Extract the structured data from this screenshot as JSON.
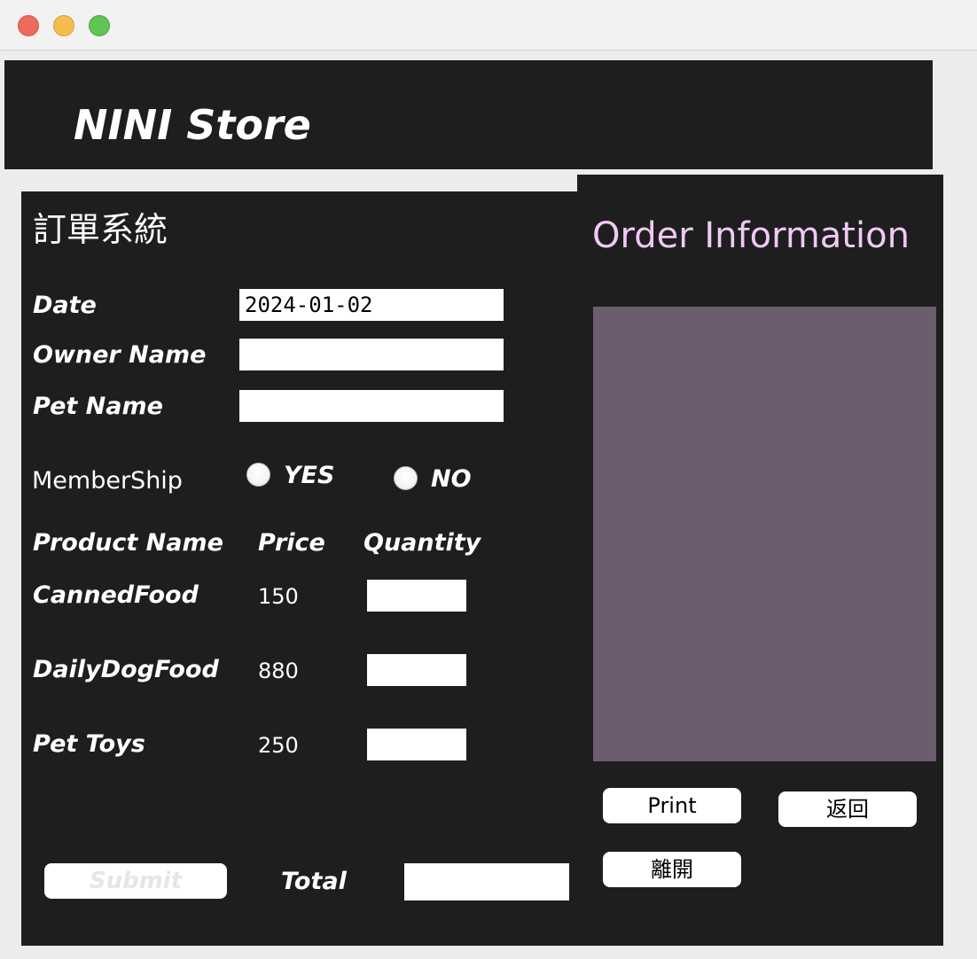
{
  "window": {
    "controls": [
      "close",
      "minimize",
      "zoom"
    ]
  },
  "header": {
    "store_name": "NINI Store"
  },
  "order_form": {
    "title": "訂單系統",
    "date_label": "Date",
    "date_value": "2024-01-02",
    "owner_label": "Owner Name",
    "owner_value": "",
    "pet_label": "Pet Name",
    "pet_value": "",
    "membership_label": "MemberShip",
    "membership_yes": "YES",
    "membership_no": "NO",
    "product_header": "Product Name",
    "price_header": "Price",
    "quantity_header": "Quantity",
    "products": [
      {
        "name": "CannedFood",
        "price": "150",
        "quantity": ""
      },
      {
        "name": "DailyDogFood",
        "price": "880",
        "quantity": ""
      },
      {
        "name": "Pet Toys",
        "price": "250",
        "quantity": ""
      }
    ],
    "submit_label": "Submit",
    "total_label": "Total",
    "total_value": ""
  },
  "order_info": {
    "title": "Order Information",
    "content": "",
    "print_label": "Print",
    "back_label": "返回",
    "exit_label": "離開"
  },
  "colors": {
    "panel_bg": "#1e1e1e",
    "order_area_bg": "#6b5c6e",
    "order_title": "#f0c8f5"
  }
}
